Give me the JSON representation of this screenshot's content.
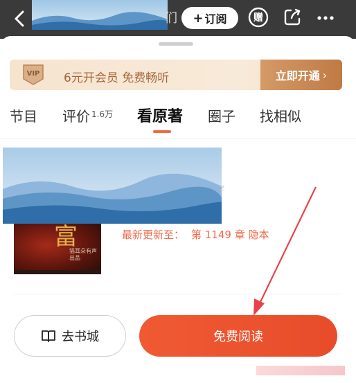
{
  "topbar": {
    "title_tail": "们",
    "subscribe_plus": "+",
    "subscribe_label": "订阅",
    "gift_glyph": "赠",
    "icons": [
      "back-icon",
      "gift-icon",
      "share-icon",
      "more-icon"
    ]
  },
  "vip": {
    "badge": "VIP",
    "text": "6元开会员 免费畅听",
    "cta": "立即开通",
    "cta_arrow": "›"
  },
  "tabs": [
    {
      "label": "节目",
      "badge": ""
    },
    {
      "label": "评价",
      "badge": "1.6万"
    },
    {
      "label": "看原著",
      "badge": "",
      "active": true
    },
    {
      "label": "圈子",
      "badge": ""
    },
    {
      "label": "找相似",
      "badge": ""
    }
  ],
  "book": {
    "cover_title": "富",
    "cover_subtitle": "猫耳朵有声出品",
    "overlay_tail": "z",
    "latest_label": "最新更新至：",
    "latest_value": "第 1149 章 隐本"
  },
  "actions": {
    "store_label": "去书城",
    "read_label": "免费阅读"
  },
  "colors": {
    "accent": "#ef5a33",
    "vip_gold": "#a4683c",
    "topbar": "#3a3a3a"
  }
}
